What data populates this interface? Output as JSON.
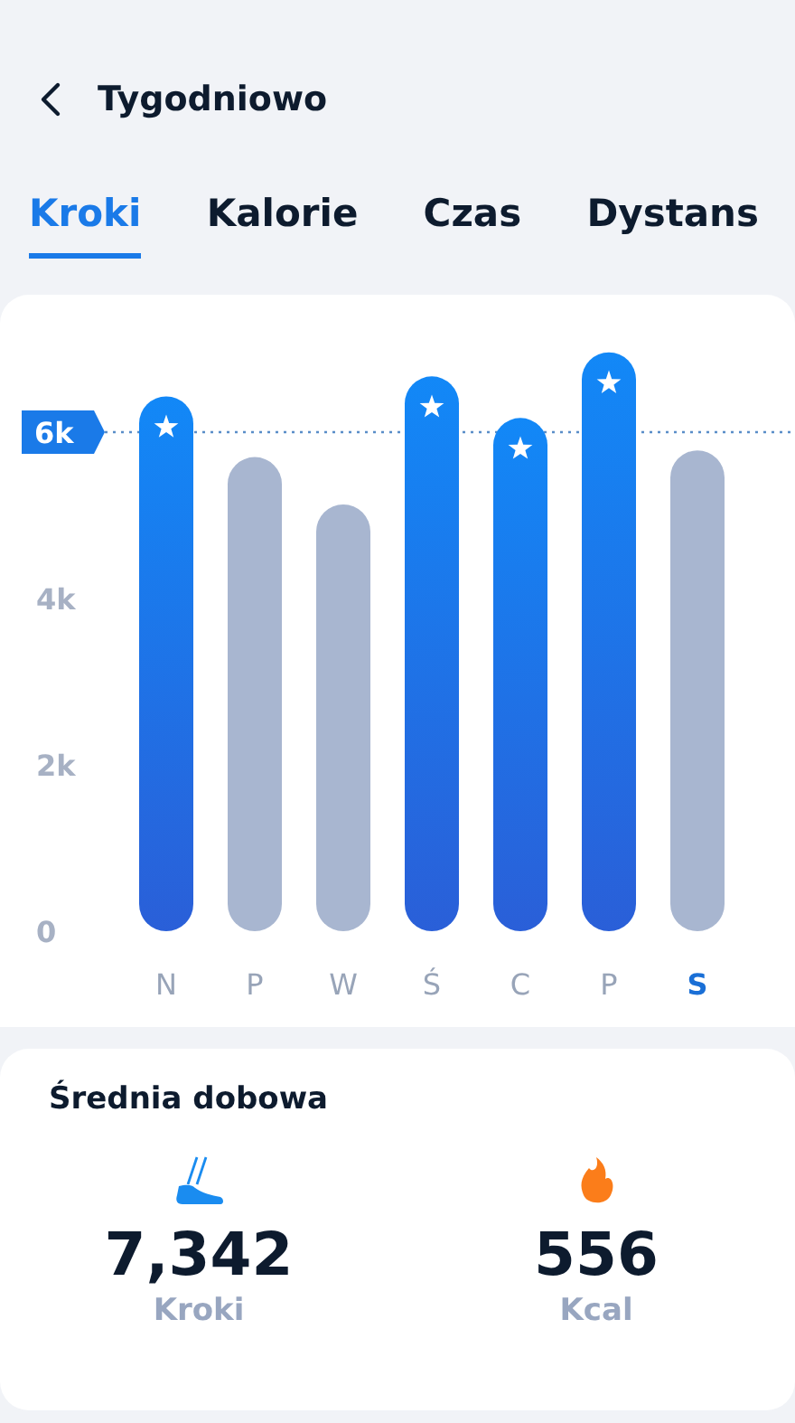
{
  "header": {
    "title": "Tygodniowo"
  },
  "tabs": [
    {
      "label": "Kroki",
      "selected": true
    },
    {
      "label": "Kalorie",
      "selected": false
    },
    {
      "label": "Czas",
      "selected": false
    },
    {
      "label": "Dystans",
      "selected": false
    }
  ],
  "chart": {
    "chart_data": {
      "type": "bar",
      "categories": [
        "N",
        "P",
        "W",
        "Ś",
        "C",
        "P",
        "S"
      ],
      "values": [
        6430,
        5700,
        5130,
        6670,
        6170,
        6960,
        5780
      ],
      "ylim": [
        0,
        7000
      ],
      "yticks": [
        {
          "value": 0,
          "label": "0"
        },
        {
          "value": 2000,
          "label": "2k"
        },
        {
          "value": 4000,
          "label": "4k"
        }
      ],
      "ref_lines": [
        {
          "axis": "y",
          "value": 6000,
          "label": "6k"
        }
      ]
    },
    "days": [
      {
        "selected": false
      },
      {
        "selected": false
      },
      {
        "selected": false
      },
      {
        "selected": false
      },
      {
        "selected": false
      },
      {
        "selected": false
      },
      {
        "selected": true
      }
    ]
  },
  "summary": {
    "title": "Średnia dobowa",
    "stats": [
      {
        "kind": "steps",
        "value": "7,342",
        "unit": "Kroki"
      },
      {
        "kind": "calories",
        "value": "556",
        "unit": "Kcal"
      }
    ]
  }
}
